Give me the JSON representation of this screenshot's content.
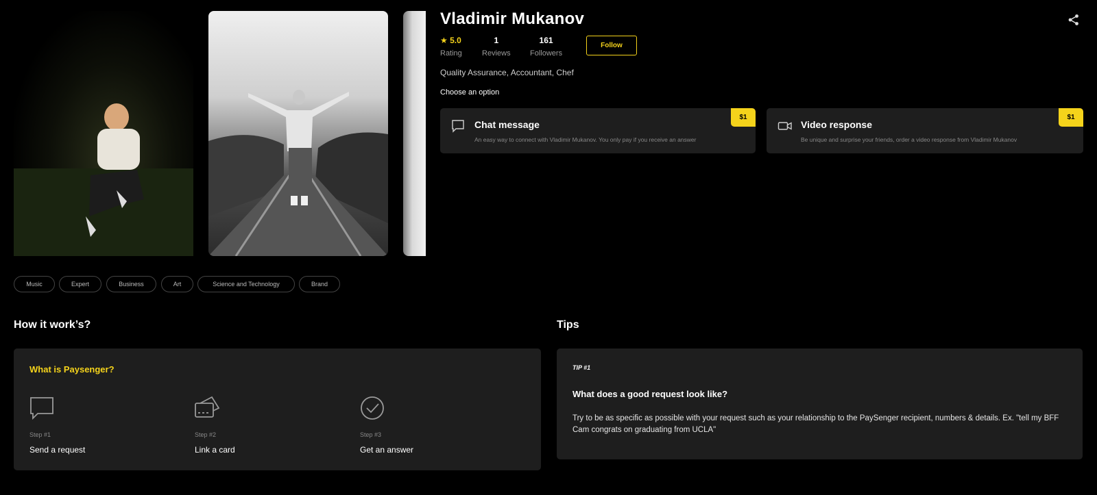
{
  "profile": {
    "name": "Vladimir Mukanov",
    "rating_value": "5.0",
    "rating_label": "Rating",
    "reviews_value": "1",
    "reviews_label": "Reviews",
    "followers_value": "161",
    "followers_label": "Followers",
    "follow_label": "Follow",
    "profession": "Quality Assurance, Accountant, Chef",
    "choose_label": "Choose an option"
  },
  "options": [
    {
      "title": "Chat message",
      "description": "An easy way to connect with Vladimir Mukanov. You only pay if you receive an answer",
      "price": "$1",
      "icon": "chat-bubble-icon"
    },
    {
      "title": "Video response",
      "description": "Be unique and surprise your friends, order a video response from Vladimir Mukanov",
      "price": "$1",
      "icon": "video-camera-icon"
    }
  ],
  "tags": [
    "Music",
    "Expert",
    "Business",
    "Art",
    "Science and Technology",
    "Brand"
  ],
  "how": {
    "section_title": "How it work’s?",
    "panel_title": "What is Paysenger?",
    "steps": [
      {
        "num": "Step #1",
        "label": "Send a request",
        "icon": "chat-bubble-icon"
      },
      {
        "num": "Step #2",
        "label": "Link a card",
        "icon": "credit-card-icon"
      },
      {
        "num": "Step #3",
        "label": "Get an answer",
        "icon": "check-circle-icon"
      }
    ]
  },
  "tips": {
    "section_title": "Tips",
    "tip_num": "TIP #1",
    "heading": "What does a good request look like?",
    "text": "Try to be as specific as possible with your request such as your relationship to the PaySenger recipient, numbers & details. Ex. \"tell my BFF Cam congrats on graduating from UCLA\""
  },
  "colors": {
    "accent": "#f5d31b",
    "card": "#1e1e1e",
    "background": "#000000"
  }
}
